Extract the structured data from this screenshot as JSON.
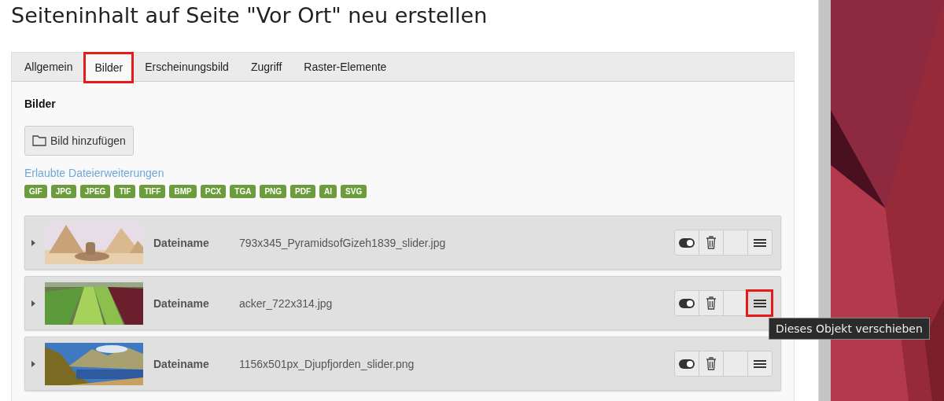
{
  "page_title": "Seiteninhalt auf Seite \"Vor Ort\" neu erstellen",
  "tabs": [
    {
      "label": "Allgemein",
      "selected": false,
      "highlighted": false
    },
    {
      "label": "Bilder",
      "selected": true,
      "highlighted": true
    },
    {
      "label": "Erscheinungsbild",
      "selected": false,
      "highlighted": false
    },
    {
      "label": "Zugriff",
      "selected": false,
      "highlighted": false
    },
    {
      "label": "Raster-Elemente",
      "selected": false,
      "highlighted": false
    }
  ],
  "section_title": "Bilder",
  "add_button": "Bild hinzufügen",
  "extensions_link": "Erlaubte Dateierweiterungen",
  "extensions": [
    "GIF",
    "JPG",
    "JPEG",
    "TIF",
    "TIFF",
    "BMP",
    "PCX",
    "TGA",
    "PNG",
    "PDF",
    "AI",
    "SVG"
  ],
  "images": [
    {
      "kind": "picture",
      "label": "Dateiname",
      "filename": "793x345_PyramidsofGizeh1839_slider.jpg",
      "visible": true,
      "move_highlighted": false
    },
    {
      "kind": "picture",
      "label": "Dateiname",
      "filename": "acker_722x314.jpg",
      "visible": true,
      "move_highlighted": true
    },
    {
      "kind": "picture",
      "label": "Dateiname",
      "filename": "1156x501px_Djupfjorden_slider.png",
      "visible": true,
      "move_highlighted": false
    }
  ],
  "tooltip": "Dieses Objekt verschieben"
}
